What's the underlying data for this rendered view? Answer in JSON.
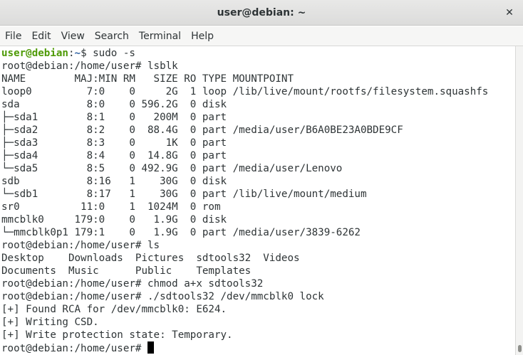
{
  "window": {
    "title": "user@debian: ~",
    "close_glyph": "✕"
  },
  "menu": [
    "File",
    "Edit",
    "View",
    "Search",
    "Terminal",
    "Help"
  ],
  "colors": {
    "prompt_user": "#4e9a06",
    "prompt_path": "#3465a4",
    "text": "#2e3436",
    "background": "#ffffff"
  },
  "terminal": {
    "first_prompt": {
      "user_host": "user@debian",
      "sep": ":",
      "path": "~",
      "suffix": "$ sudo -s"
    },
    "lines": [
      "root@debian:/home/user# lsblk",
      "NAME        MAJ:MIN RM   SIZE RO TYPE MOUNTPOINT",
      "loop0         7:0    0     2G  1 loop /lib/live/mount/rootfs/filesystem.squashfs",
      "sda           8:0    0 596.2G  0 disk",
      "├─sda1        8:1    0   200M  0 part",
      "├─sda2        8:2    0  88.4G  0 part /media/user/B6A0BE23A0BDE9CF",
      "├─sda3        8:3    0     1K  0 part",
      "├─sda4        8:4    0  14.8G  0 part",
      "└─sda5        8:5    0 492.9G  0 part /media/user/Lenovo",
      "sdb           8:16   1    30G  0 disk",
      "└─sdb1        8:17   1    30G  0 part /lib/live/mount/medium",
      "sr0          11:0    1  1024M  0 rom",
      "mmcblk0     179:0    0   1.9G  0 disk",
      "└─mmcblk0p1 179:1    0   1.9G  0 part /media/user/3839-6262",
      "root@debian:/home/user# ls",
      "Desktop    Downloads  Pictures  sdtools32  Videos",
      "Documents  Music      Public    Templates",
      "root@debian:/home/user# chmod a+x sdtools32",
      "root@debian:/home/user# ./sdtools32 /dev/mmcblk0 lock",
      "[+] Found RCA for /dev/mmcblk0: E624.",
      "[+] Writing CSD.",
      "[+] Write protection state: Temporary."
    ],
    "current_prompt": "root@debian:/home/user# "
  }
}
